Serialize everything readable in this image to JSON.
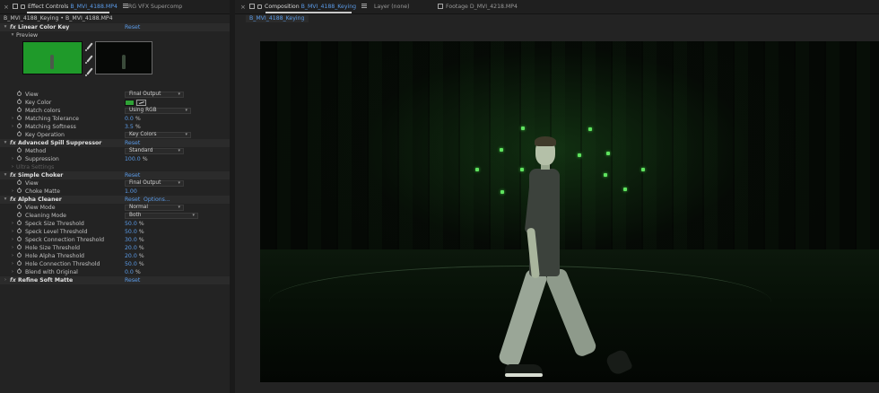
{
  "left_tabs": {
    "effect_controls": {
      "prefix": "Effect Controls",
      "file": "B_MVI_4188.MP4"
    },
    "second_tab": "RG VFX Supercomp"
  },
  "right_tabs": {
    "composition": {
      "prefix": "Composition",
      "name": "B_MVI_4188_Keying"
    },
    "layer": {
      "prefix": "Layer",
      "value": "(none)"
    },
    "footage": {
      "prefix": "Footage",
      "value": "D_MVI_4218.MP4"
    }
  },
  "breadcrumb": "B_MVI_4188_Keying • B_MVI_4188.MP4",
  "comp_label": "B_MVI_4188_Keying",
  "effects": {
    "reset": "Reset",
    "options": "Options...",
    "linear_color_key": {
      "title": "Linear Color Key",
      "preview": "Preview",
      "view": {
        "label": "View",
        "value": "Final Output"
      },
      "key_color": {
        "label": "Key Color",
        "color": "#2fa236"
      },
      "match_colors": {
        "label": "Match colors",
        "value": "Using RGB"
      },
      "matching_tolerance": {
        "label": "Matching Tolerance",
        "value": "0.0",
        "unit": "%"
      },
      "matching_softness": {
        "label": "Matching Softness",
        "value": "3.5",
        "unit": "%"
      },
      "key_operation": {
        "label": "Key Operation",
        "value": "Key Colors"
      }
    },
    "advanced_spill_suppressor": {
      "title": "Advanced Spill Suppressor",
      "method": {
        "label": "Method",
        "value": "Standard"
      },
      "suppression": {
        "label": "Suppression",
        "value": "100.0",
        "unit": "%"
      },
      "ultra_settings": "Ultra Settings"
    },
    "simple_choker": {
      "title": "Simple Choker",
      "view": {
        "label": "View",
        "value": "Final Output"
      },
      "choke_matte": {
        "label": "Choke Matte",
        "value": "1.00"
      }
    },
    "alpha_cleaner": {
      "title": "Alpha Cleaner",
      "view_mode": {
        "label": "View Mode",
        "value": "Normal"
      },
      "cleaning_mode": {
        "label": "Cleaning Mode",
        "value": "Both"
      },
      "speck_size_threshold": {
        "label": "Speck Size Threshold",
        "value": "50.0",
        "unit": "%"
      },
      "speck_level_threshold": {
        "label": "Speck Level Threshold",
        "value": "50.0",
        "unit": "%"
      },
      "speck_connection_threshold": {
        "label": "Speck Connection Threshold",
        "value": "30.0",
        "unit": "%"
      },
      "hole_size_threshold": {
        "label": "Hole Size Threshold",
        "value": "20.0",
        "unit": "%"
      },
      "hole_alpha_threshold": {
        "label": "Hole Alpha Threshold",
        "value": "20.0",
        "unit": "%"
      },
      "hole_connection_threshold": {
        "label": "Hole Connection Threshold",
        "value": "50.0",
        "unit": "%"
      },
      "blend_with_original": {
        "label": "Blend with Original",
        "value": "0.0",
        "unit": "%"
      }
    },
    "refine_soft_matte": {
      "title": "Refine Soft Matte"
    }
  },
  "icons": {
    "fx": "fx",
    "expand_down": "▾",
    "collapse_right": "›",
    "dropdown_arrow": "▾",
    "close": "×"
  }
}
